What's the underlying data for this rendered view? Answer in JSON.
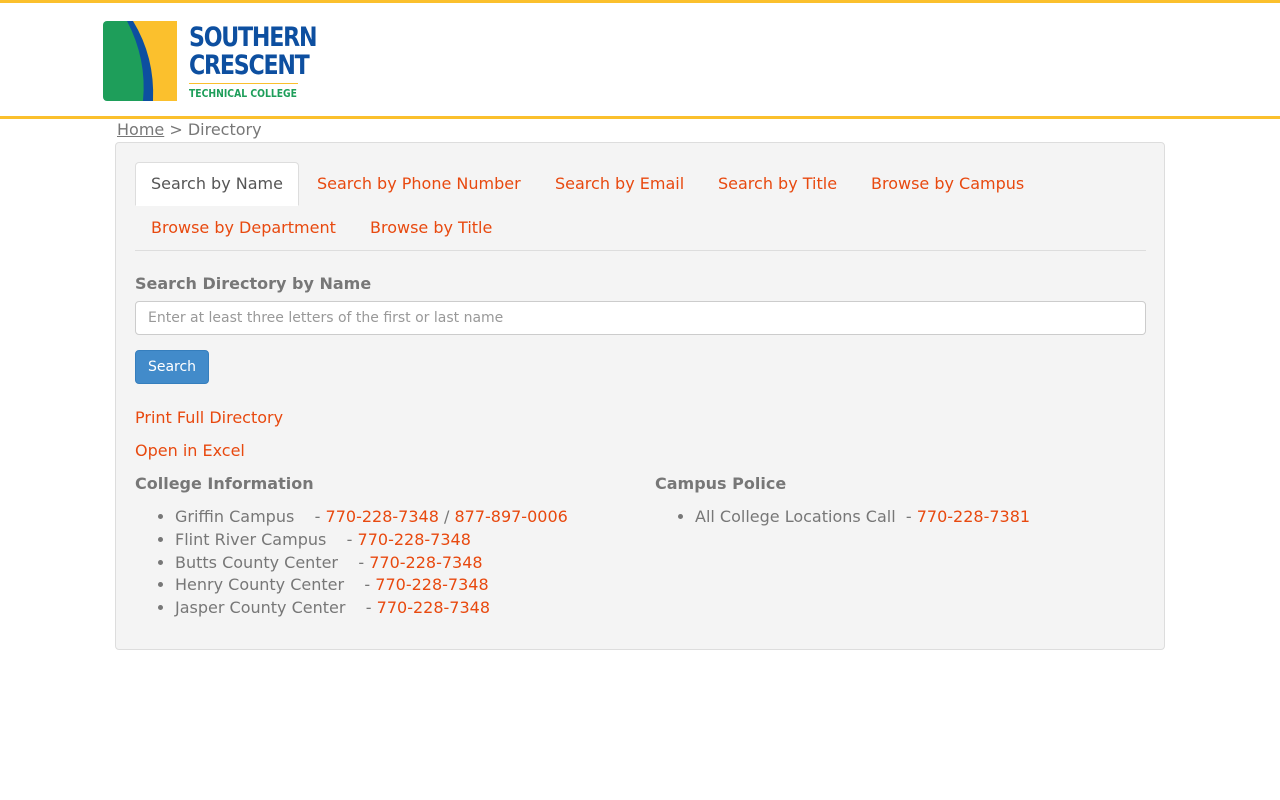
{
  "logo": {
    "line1": "SOUTHERN",
    "line2": "CRESCENT",
    "line3": "TECHNICAL COLLEGE",
    "colors": {
      "blue": "#0d4fa0",
      "green": "#1e9e5a",
      "yellow": "#fbc02d"
    }
  },
  "breadcrumb": {
    "home": "Home",
    "separator": ">",
    "current": "Directory"
  },
  "tabs": [
    {
      "label": "Search by Name",
      "active": true
    },
    {
      "label": "Search by Phone Number",
      "active": false
    },
    {
      "label": "Search by Email",
      "active": false
    },
    {
      "label": "Search by Title",
      "active": false
    },
    {
      "label": "Browse by Campus",
      "active": false
    },
    {
      "label": "Browse by Department",
      "active": false
    },
    {
      "label": "Browse by Title",
      "active": false
    }
  ],
  "search": {
    "heading": "Search Directory by Name",
    "placeholder": "Enter at least three letters of the first or last name",
    "value": "",
    "button": "Search"
  },
  "links": {
    "print": "Print Full Directory",
    "excel": "Open in Excel"
  },
  "college_info": {
    "heading": "College Information",
    "items": [
      {
        "name": "Griffin Campus",
        "sep": "-",
        "phone": "770-228-7348",
        "slash": "/",
        "phone2": "877-897-0006"
      },
      {
        "name": "Flint River Campus",
        "sep": "-",
        "phone": "770-228-7348"
      },
      {
        "name": "Butts County Center",
        "sep": "-",
        "phone": "770-228-7348"
      },
      {
        "name": "Henry County Center",
        "sep": "-",
        "phone": "770-228-7348"
      },
      {
        "name": "Jasper County Center",
        "sep": "-",
        "phone": "770-228-7348"
      }
    ]
  },
  "campus_police": {
    "heading": "Campus Police",
    "items": [
      {
        "name": "All College Locations Call",
        "sep": "-",
        "phone": "770-228-7381"
      }
    ]
  },
  "colors": {
    "accent": "#e8490f",
    "button": "#428bca",
    "header_line": "#fbc02d",
    "panel_bg": "#f4f4f4"
  }
}
